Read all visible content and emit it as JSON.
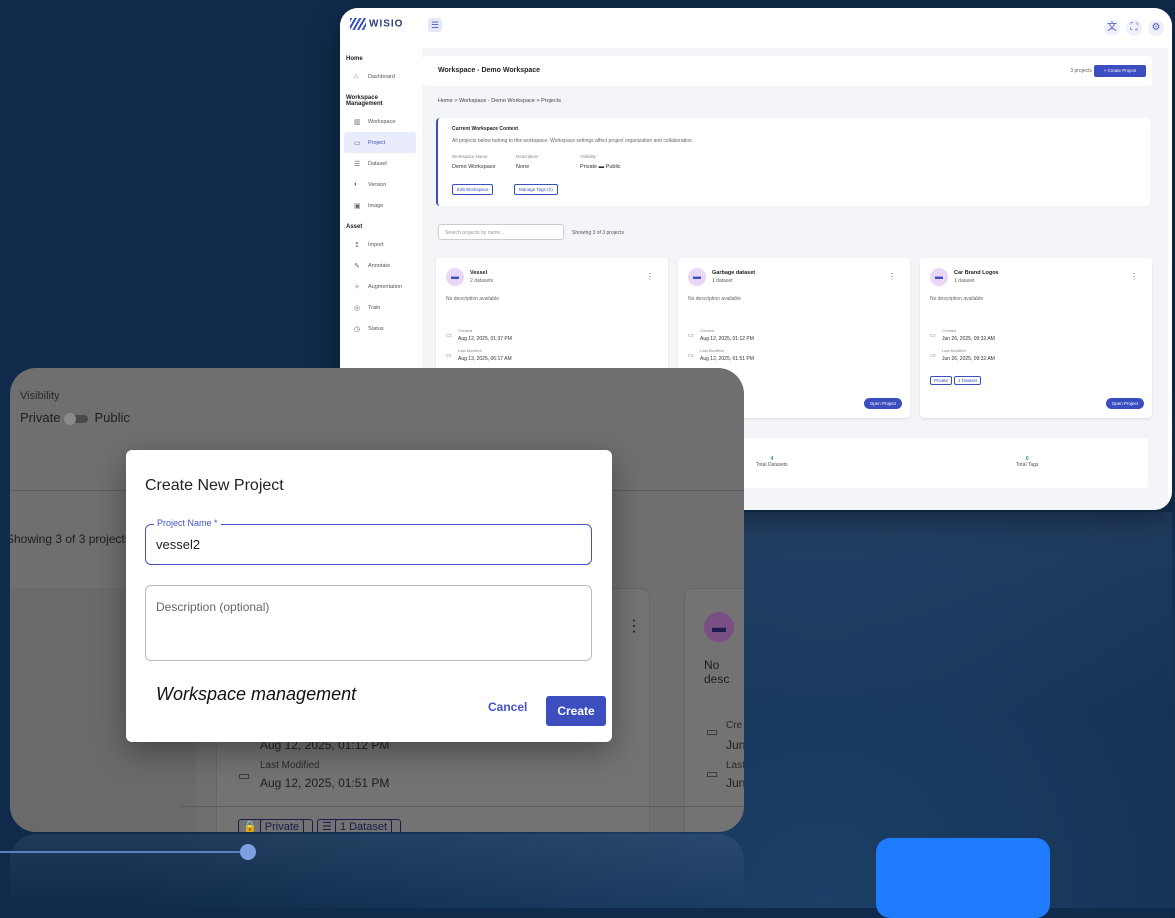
{
  "app": {
    "logo": "WISIO",
    "menu_icon": "☰",
    "top_icons": [
      "translate-icon",
      "fullscreen-icon",
      "settings-icon"
    ]
  },
  "sidebar": {
    "home_header": "Home",
    "dashboard": "Dashboard",
    "workspace_header": "Workspace Management",
    "items": [
      "Workspace",
      "Project",
      "Dataset",
      "Version",
      "Image"
    ],
    "asset_header": "Asset",
    "asset_items": [
      "Import",
      "Annotate",
      "Augmentation",
      "Train",
      "Status"
    ]
  },
  "page": {
    "title": "Workspace - Demo Workspace",
    "project_count": "3 projects",
    "create_btn": "+ Create Project",
    "breadcrumb": "Home  >  Workspace - Demo Workspace  >  Projects"
  },
  "context": {
    "heading": "Current Workspace Context",
    "desc": "All projects below belong to this workspace. Workspace settings affect project organization and collaboration.",
    "label_name": "Workspace Name",
    "label_desc": "Description",
    "label_vis": "Visibility",
    "val_name": "Demo Workspace",
    "val_desc": "None",
    "val_vis": "Private  ▬  Public",
    "edit_btn": "Edit Workspace",
    "tags_btn": "Manage Tags (0)"
  },
  "search": {
    "placeholder": "Search projects by name...",
    "showing": "Showing 3 of 3 projects"
  },
  "projects": [
    {
      "name": "Vessel",
      "count": "2 datasets",
      "desc": "No description available",
      "created_label": "Created",
      "created": "Aug 12, 2025, 01:37 PM",
      "modified_label": "Last Modified",
      "modified": "Aug 13, 2025, 06:17 AM"
    },
    {
      "name": "Garbage dataset",
      "count": "1 dataset",
      "desc": "No description available",
      "created_label": "Created",
      "created": "Aug 12, 2025, 01:12 PM",
      "modified_label": "Last Modified",
      "modified": "Aug 12, 2025, 01:51 PM",
      "tag_dataset": "Dataset",
      "open": "Open Project"
    },
    {
      "name": "Car Brand Logos",
      "count": "1 dataset",
      "desc": "No description available",
      "created_label": "Created",
      "created": "Jun 26, 2025, 09:32 AM",
      "modified_label": "Last Modified",
      "modified": "Jun 26, 2025, 09:32 AM",
      "tag_private": "Private",
      "tag_dataset": "1 Dataset",
      "open": "Open Project"
    }
  ],
  "stats": {
    "datasets_value": "4",
    "datasets_label": "Total Datasets",
    "tags_value": "0",
    "tags_label": "Total Tags"
  },
  "zoom": {
    "visibility_label": "Visibility",
    "private": "Private",
    "public": "Public",
    "showing": "Showing 3 of 3 projects",
    "no_desc": "No desc",
    "created_date": "Aug 12, 2025, 01:12 PM",
    "last_modified_label": "Last Modified",
    "last_modified": "Aug 12, 2025, 01:51 PM",
    "right_created_label": "Cre",
    "right_created": "Jun",
    "right_last_label": "Last",
    "right_last": "Jun",
    "tag_private": "Private",
    "tag_dataset": "1 Dataset"
  },
  "modal": {
    "title": "Create New Project",
    "name_label": "Project Name *",
    "name_value": "vessel2",
    "desc_placeholder": "Description (optional)",
    "cancel": "Cancel",
    "create": "Create"
  },
  "tagline": "Workspace management"
}
